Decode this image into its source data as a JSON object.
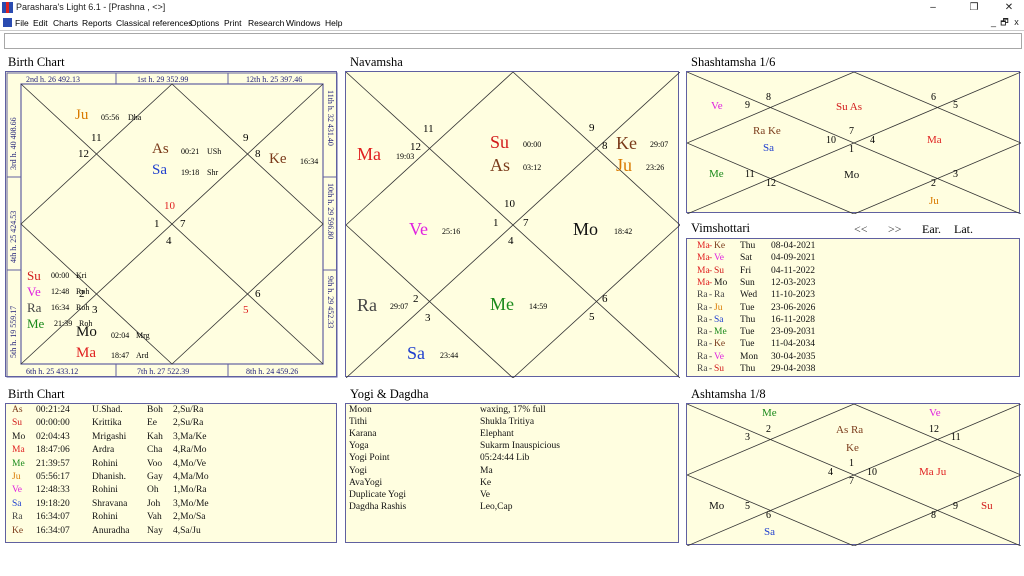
{
  "window": {
    "title": "Parashara's Light 6.1 - [Prashna , <>]"
  },
  "menu": [
    "File",
    "Edit",
    "Charts",
    "Reports",
    "Classical references",
    "Options",
    "Print",
    "Research",
    "Windows",
    "Help"
  ],
  "window_buttons": {
    "minimize": "–",
    "restore": "❐",
    "close": "✕"
  },
  "mdi_buttons": {
    "minimize": "_",
    "restore": "🗗",
    "close": "x"
  },
  "colors": {
    "Su": "#d21a1a",
    "Mo": "#111111",
    "Ma": "#e02020",
    "Me": "#1a8a1a",
    "Ju": "#d97a00",
    "Ve": "#e020e0",
    "Sa": "#1f3fcf",
    "Ra": "#444444",
    "Ke": "#7a3a1a",
    "As": "#7a3a1a",
    "house": "#000000",
    "asc_house": "#e02020",
    "panel_border": "#6060a0",
    "panel_bg": "#fffee0"
  },
  "birth_chart": {
    "title": "Birth Chart",
    "headers": {
      "top": [
        "2nd h.  26  492.13",
        "1st h.  29  352.99",
        "12th h.  25  397.46"
      ],
      "bottom": [
        "6th h.  25  433.12",
        "7th h.  27  522.39",
        "8th h.  24  459.26"
      ],
      "left": [
        "3rd h.  40  408.66",
        "4th h.  25  424.53",
        "5th h.  19  559.17"
      ],
      "right": [
        "11th h.  32  431.40",
        "10th h.  29  596.80",
        "9th h.  29  452.33"
      ]
    },
    "houses": [
      "11",
      "12",
      "9",
      "8",
      "10",
      "1",
      "7",
      "4",
      "2",
      "3",
      "6",
      "5"
    ],
    "planets": [
      {
        "p": "Ju",
        "deg": "05:56",
        "nak": "Dha"
      },
      {
        "p": "As",
        "deg": "00:21",
        "nak": "USh"
      },
      {
        "p": "Sa",
        "deg": "19:18",
        "nak": "Shr"
      },
      {
        "p": "Ke",
        "deg": "16:34",
        "nak": ""
      },
      {
        "p": "Su",
        "deg": "00:00",
        "nak": "Kri"
      },
      {
        "p": "Ve",
        "deg": "12:48",
        "nak": "Roh"
      },
      {
        "p": "Ra",
        "deg": "16:34",
        "nak": "Roh"
      },
      {
        "p": "Me",
        "deg": "21:39",
        "nak": "Roh"
      },
      {
        "p": "Mo",
        "deg": "02:04",
        "nak": "Mrg"
      },
      {
        "p": "Ma",
        "deg": "18:47",
        "nak": "Ard"
      }
    ]
  },
  "navamsha": {
    "title": "Navamsha",
    "houses": [
      "11",
      "12",
      "9",
      "8",
      "10",
      "1",
      "7",
      "4",
      "2",
      "3",
      "6",
      "5"
    ],
    "planets": [
      {
        "p": "Ma",
        "deg": "19:03"
      },
      {
        "p": "Su",
        "deg": "00:00"
      },
      {
        "p": "As",
        "deg": "03:12"
      },
      {
        "p": "Ke",
        "deg": "29:07"
      },
      {
        "p": "Ju",
        "deg": "23:26"
      },
      {
        "p": "Ve",
        "deg": "25:16"
      },
      {
        "p": "Mo",
        "deg": "18:42"
      },
      {
        "p": "Ra",
        "deg": "29:07"
      },
      {
        "p": "Me",
        "deg": "14:59"
      },
      {
        "p": "Sa",
        "deg": "23:44"
      }
    ]
  },
  "shashtamsha": {
    "title": "Shashtamsha 1/6",
    "houses": [
      "9",
      "8",
      "6",
      "5",
      "10",
      "7",
      "4",
      "1",
      "11",
      "12",
      "2",
      "3"
    ],
    "planets": [
      "Ve",
      "Su As",
      "Ra Ke",
      "Sa",
      "Ma",
      "Me",
      "Mo",
      "Ju"
    ]
  },
  "vimshottari": {
    "title": "Vimshottari",
    "controls": [
      "<<",
      ">>",
      "Ear.",
      "Lat."
    ],
    "rows": [
      {
        "md": "Ma",
        "ad": "Ke",
        "day": "Thu",
        "date": "08-04-2021"
      },
      {
        "md": "Ma",
        "ad": "Ve",
        "day": "Sat",
        "date": "04-09-2021"
      },
      {
        "md": "Ma",
        "ad": "Su",
        "day": "Fri",
        "date": "04-11-2022"
      },
      {
        "md": "Ma",
        "ad": "Mo",
        "day": "Sun",
        "date": "12-03-2023"
      },
      {
        "md": "Ra",
        "ad": "Ra",
        "day": "Wed",
        "date": "11-10-2023"
      },
      {
        "md": "Ra",
        "ad": "Ju",
        "day": "Tue",
        "date": "23-06-2026"
      },
      {
        "md": "Ra",
        "ad": "Sa",
        "day": "Thu",
        "date": "16-11-2028"
      },
      {
        "md": "Ra",
        "ad": "Me",
        "day": "Tue",
        "date": "23-09-2031"
      },
      {
        "md": "Ra",
        "ad": "Ke",
        "day": "Tue",
        "date": "11-04-2034"
      },
      {
        "md": "Ra",
        "ad": "Ve",
        "day": "Mon",
        "date": "30-04-2035"
      },
      {
        "md": "Ra",
        "ad": "Su",
        "day": "Thu",
        "date": "29-04-2038"
      }
    ]
  },
  "birth_table": {
    "title": "Birth Chart",
    "rows": [
      {
        "p": "As",
        "deg": "00:21:24",
        "nak": "U.Shad.",
        "syl": "Boh",
        "pada": "2,Su/Ra"
      },
      {
        "p": "Su",
        "deg": "00:00:00",
        "nak": "Krittika",
        "syl": "Ee",
        "pada": "2,Su/Ra"
      },
      {
        "p": "Mo",
        "deg": "02:04:43",
        "nak": "Mrigashi",
        "syl": "Kah",
        "pada": "3,Ma/Ke"
      },
      {
        "p": "Ma",
        "deg": "18:47:06",
        "nak": "Ardra",
        "syl": "Cha",
        "pada": "4,Ra/Mo"
      },
      {
        "p": "Me",
        "deg": "21:39:57",
        "nak": "Rohini",
        "syl": "Voo",
        "pada": "4,Mo/Ve"
      },
      {
        "p": "Ju",
        "deg": "05:56:17",
        "nak": "Dhanish.",
        "syl": "Gay",
        "pada": "4,Ma/Mo"
      },
      {
        "p": "Ve",
        "deg": "12:48:33",
        "nak": "Rohini",
        "syl": "Oh",
        "pada": "1,Mo/Ra"
      },
      {
        "p": "Sa",
        "deg": "19:18:20",
        "nak": "Shravana",
        "syl": "Joh",
        "pada": "3,Mo/Me"
      },
      {
        "p": "Ra",
        "deg": "16:34:07",
        "nak": "Rohini",
        "syl": "Vah",
        "pada": "2,Mo/Sa"
      },
      {
        "p": "Ke",
        "deg": "16:34:07",
        "nak": "Anuradha",
        "syl": "Nay",
        "pada": "4,Sa/Ju"
      }
    ]
  },
  "yogi": {
    "title": "Yogi & Dagdha",
    "rows": [
      {
        "k": "Moon",
        "v": "waxing, 17% full"
      },
      {
        "k": "Tithi",
        "v": "Shukla  Tritiya"
      },
      {
        "k": "Karana",
        "v": "Elephant"
      },
      {
        "k": "Yoga",
        "v": "Sukarm Inauspicious"
      },
      {
        "k": "Yogi Point",
        "v": "05:24:44 Lib"
      },
      {
        "k": "Yogi",
        "v": "Ma"
      },
      {
        "k": "AvaYogi",
        "v": "Ke"
      },
      {
        "k": "Duplicate Yogi",
        "v": "Ve"
      },
      {
        "k": "Dagdha Rashis",
        "v": "Leo,Cap"
      }
    ]
  },
  "ashtamsha": {
    "title": "Ashtamsha 1/8",
    "houses": [
      "3",
      "2",
      "12",
      "11",
      "4",
      "1",
      "10",
      "7",
      "5",
      "6",
      "8",
      "9"
    ],
    "planets": [
      "Me",
      "Ve",
      "As Ra",
      "Ke",
      "Ma Ju",
      "Mo",
      "Su",
      "Sa"
    ]
  }
}
